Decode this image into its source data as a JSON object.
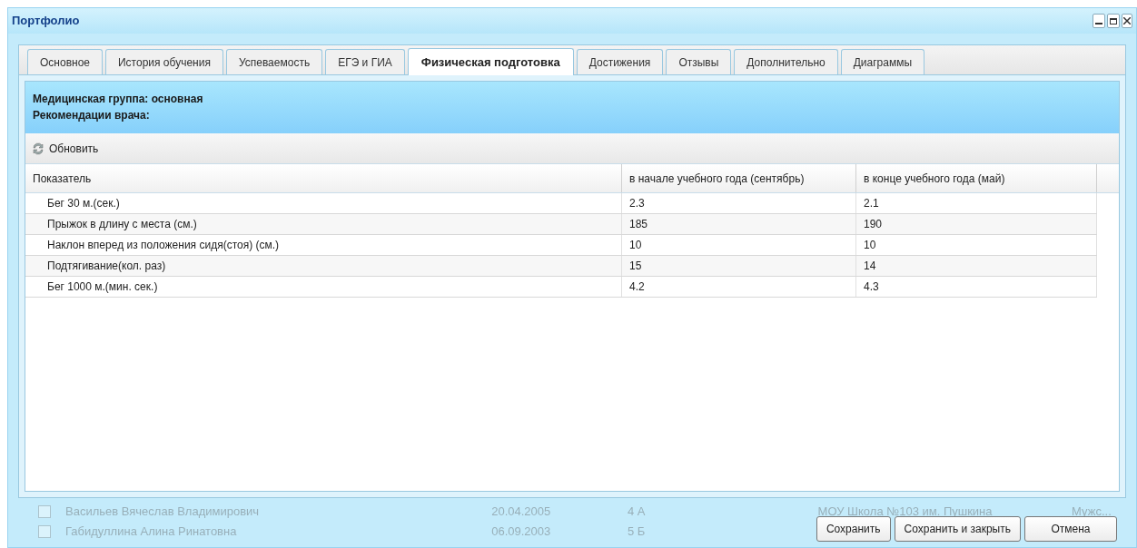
{
  "window": {
    "title": "Портфолио"
  },
  "tabs": [
    {
      "label": "Основное",
      "selected": false
    },
    {
      "label": "История обучения",
      "selected": false
    },
    {
      "label": "Успеваемость",
      "selected": false
    },
    {
      "label": "ЕГЭ и ГИА",
      "selected": false
    },
    {
      "label": "Физическая подготовка",
      "selected": true
    },
    {
      "label": "Достижения",
      "selected": false
    },
    {
      "label": "Отзывы",
      "selected": false
    },
    {
      "label": "Дополнительно",
      "selected": false
    },
    {
      "label": "Диаграммы",
      "selected": false
    }
  ],
  "info": {
    "medical_group": "Медицинская группа: основная",
    "doctor_recommendations": "Рекомендации врача:"
  },
  "toolbar": {
    "refresh": "Обновить"
  },
  "table": {
    "columns": [
      "Показатель",
      "в начале учебного года (сентябрь)",
      "в конце учебного года (май)"
    ],
    "rows": [
      [
        "Бег 30 м.(сек.)",
        "2.3",
        "2.1"
      ],
      [
        "Прыжок в длину с места (см.)",
        "185",
        "190"
      ],
      [
        "Наклон вперед из положения сидя(стоя) (см.)",
        "10",
        "10"
      ],
      [
        "Подтягивание(кол. раз)",
        "15",
        "14"
      ],
      [
        "Бег 1000 м.(мин. сек.)",
        "4.2",
        "4.3"
      ]
    ]
  },
  "background_rows": [
    [
      "Васильев Вячеслав Владимирович",
      "20.04.2005",
      "4 А",
      "МОУ Школа №103 им. Пушкина",
      "Мужс..."
    ],
    [
      "Габидуллина Алина Ринатовна",
      "06.09.2003",
      "5 Б",
      "",
      ""
    ]
  ],
  "buttons": [
    "Сохранить",
    "Сохранить и закрыть",
    "Отмена"
  ]
}
